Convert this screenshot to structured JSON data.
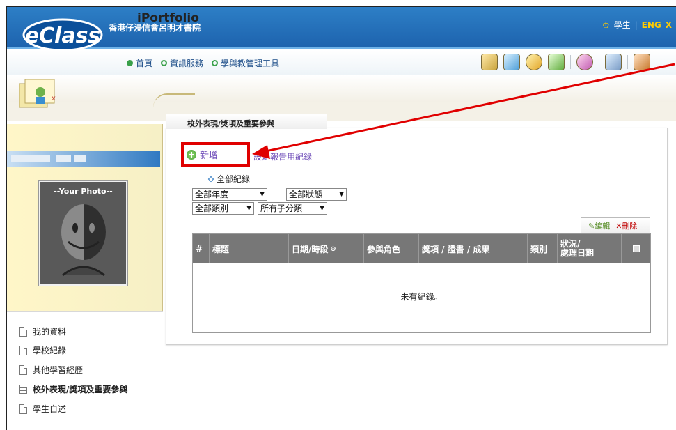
{
  "header": {
    "school_name": "香港仔浸信會呂明才書院",
    "user_role": "學生",
    "separator": "|",
    "lang": "ENG",
    "truncated": "X"
  },
  "nav": {
    "items": [
      "首頁",
      "資訊服務",
      "學與教管理工具"
    ]
  },
  "module": {
    "title": "iPortfolio"
  },
  "sidebar": {
    "photo_label": "--Your Photo--",
    "menu": [
      "我的資料",
      "學校紀錄",
      "其他學習經歷",
      "校外表現/獎項及重要參與",
      "學生自述"
    ]
  },
  "main": {
    "section_tab": "校外表現/獎項及重要參與",
    "add_label": "新增",
    "report_link": "設定報告用紀錄",
    "all_records": "全部紀錄",
    "filters": {
      "year": "全部年度",
      "status": "全部狀態",
      "category": "全部類別",
      "subcategory": "所有子分類"
    },
    "edit_label": "編輯",
    "delete_label": "刪除",
    "table": {
      "columns": [
        "#",
        "標題",
        "日期/時段",
        "參與角色",
        "獎項 / 證書 / 成果",
        "類別",
        "狀況/\n處理日期"
      ],
      "empty_text": "未有紀錄。"
    }
  },
  "colors": {
    "header_blue": "#1d62ad",
    "highlight": "#e00000",
    "link_purple": "#6d4bb8",
    "table_head": "#777777"
  }
}
